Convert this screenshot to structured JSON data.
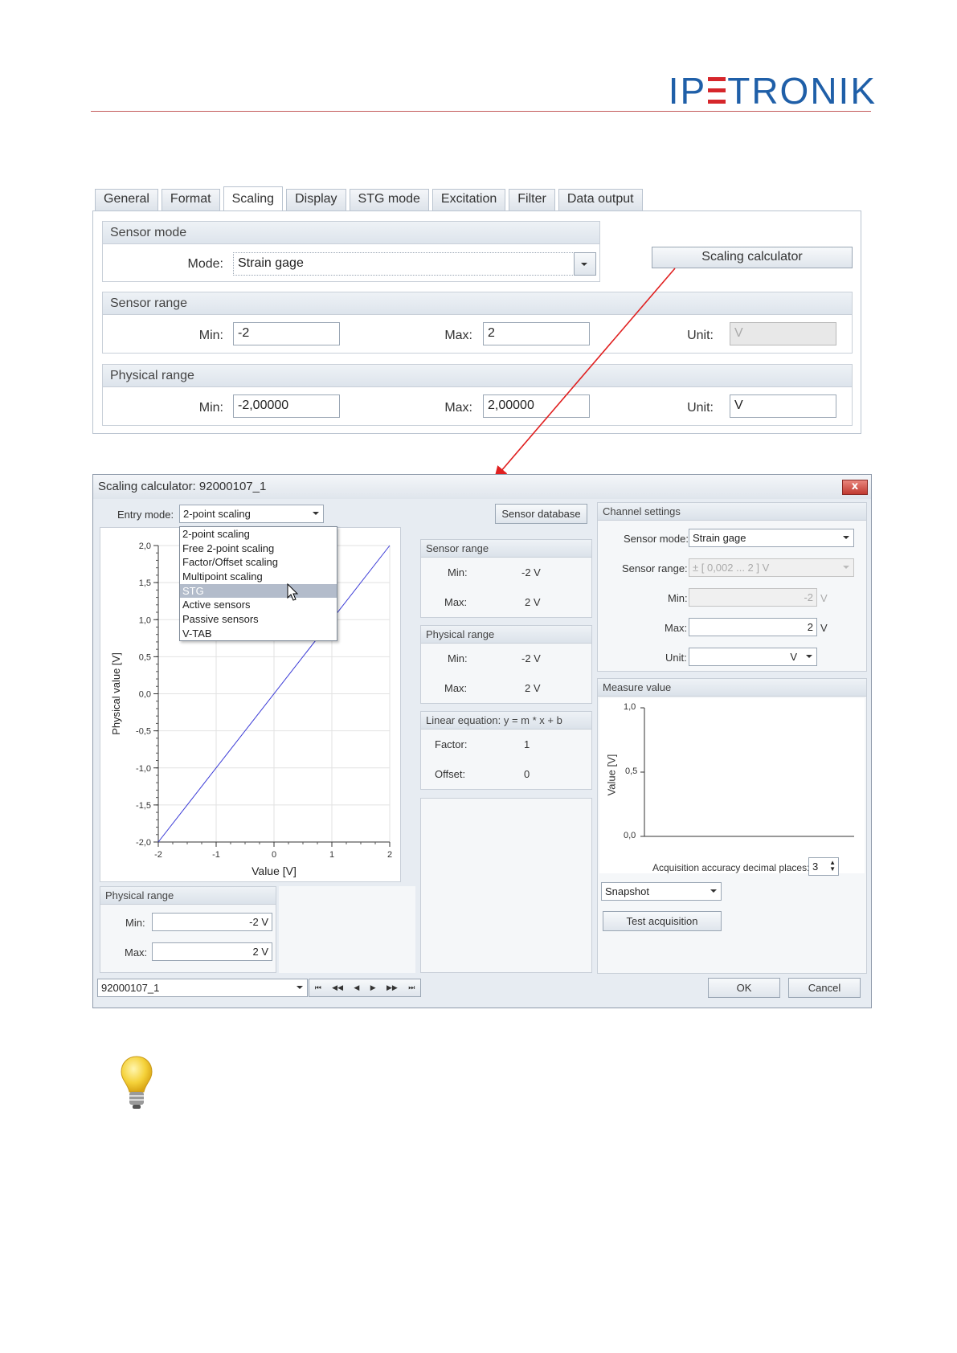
{
  "logo": {
    "text_left": "IP",
    "text_right": "TRONIK"
  },
  "tabs": [
    {
      "label": "General"
    },
    {
      "label": "Format"
    },
    {
      "label": "Scaling"
    },
    {
      "label": "Display"
    },
    {
      "label": "STG mode"
    },
    {
      "label": "Excitation"
    },
    {
      "label": "Filter"
    },
    {
      "label": "Data output"
    }
  ],
  "sensor_mode": {
    "header": "Sensor mode",
    "mode_label": "Mode:",
    "mode_value": "Strain gage"
  },
  "scaling_calculator_button": "Scaling calculator",
  "sensor_range": {
    "header": "Sensor range",
    "min_label": "Min:",
    "min_value": "-2",
    "max_label": "Max:",
    "max_value": "2",
    "unit_label": "Unit:",
    "unit_value": "V"
  },
  "physical_range": {
    "header": "Physical range",
    "min_label": "Min:",
    "min_value": "-2,00000",
    "max_label": "Max:",
    "max_value": "2,00000",
    "unit_label": "Unit:",
    "unit_value": "V"
  },
  "dialog": {
    "title": "Scaling calculator: 92000107_1",
    "close": "x",
    "entry_mode_label": "Entry mode:",
    "entry_mode_value": "2-point scaling",
    "sensor_database_button": "Sensor database",
    "menu_items": [
      "2-point scaling",
      "Free 2-point scaling",
      "Factor/Offset scaling",
      "Multipoint scaling",
      "STG",
      "Active sensors",
      "Passive sensors",
      "V-TAB"
    ],
    "sensor_range": {
      "header": "Sensor range",
      "min_label": "Min:",
      "min_value": "-2 V",
      "max_label": "Max:",
      "max_value": "2 V"
    },
    "physical_range": {
      "header": "Physical range",
      "min_label": "Min:",
      "min_value": "-2 V",
      "max_label": "Max:",
      "max_value": "2 V"
    },
    "linear_equation": {
      "header": "Linear equation: y = m * x + b",
      "factor_label": "Factor:",
      "factor_value": "1",
      "offset_label": "Offset:",
      "offset_value": "0"
    },
    "channel_settings": {
      "header": "Channel settings",
      "sensor_mode_label": "Sensor mode:",
      "sensor_mode_value": "Strain gage",
      "sensor_range_label": "Sensor range:",
      "sensor_range_value": "± [ 0,002 ... 2 ] V",
      "min_label": "Min:",
      "min_value": "-2",
      "min_unit": "V",
      "max_label": "Max:",
      "max_value": "2",
      "max_unit": "V",
      "unit_label": "Unit:",
      "unit_value": "V"
    },
    "measure_value": {
      "header": "Measure value",
      "ylabel": "Value [V]",
      "yticks": [
        "1,0",
        "0,5",
        "0,0"
      ],
      "accuracy_label": "Acquisition accuracy decimal places:",
      "accuracy_value": "3",
      "snapshot_value": "Snapshot",
      "test_button": "Test acquisition"
    },
    "bottom_physical_range": {
      "header": "Physical range",
      "min_label": "Min:",
      "min_value": "-2 V",
      "max_label": "Max:",
      "max_value": "2 V"
    },
    "channel_select": "92000107_1",
    "ok_button": "OK",
    "cancel_button": "Cancel"
  },
  "chart_data": {
    "type": "line",
    "xlabel": "Value [V]",
    "ylabel": "Physical value [V]",
    "xlim": [
      -2,
      2
    ],
    "ylim": [
      -2,
      2
    ],
    "x_tick_labels": [
      "-2",
      "-1",
      "0",
      "1",
      "2"
    ],
    "y_tick_labels": [
      "2,0",
      "1,5",
      "1,0",
      "0,5",
      "0,0",
      "-0,5",
      "-1,0",
      "-1,5",
      "-2,0"
    ],
    "series": [
      {
        "x": [
          -2,
          2
        ],
        "y": [
          -2,
          2
        ],
        "color": "#3a3ad6"
      }
    ],
    "grid": true
  }
}
